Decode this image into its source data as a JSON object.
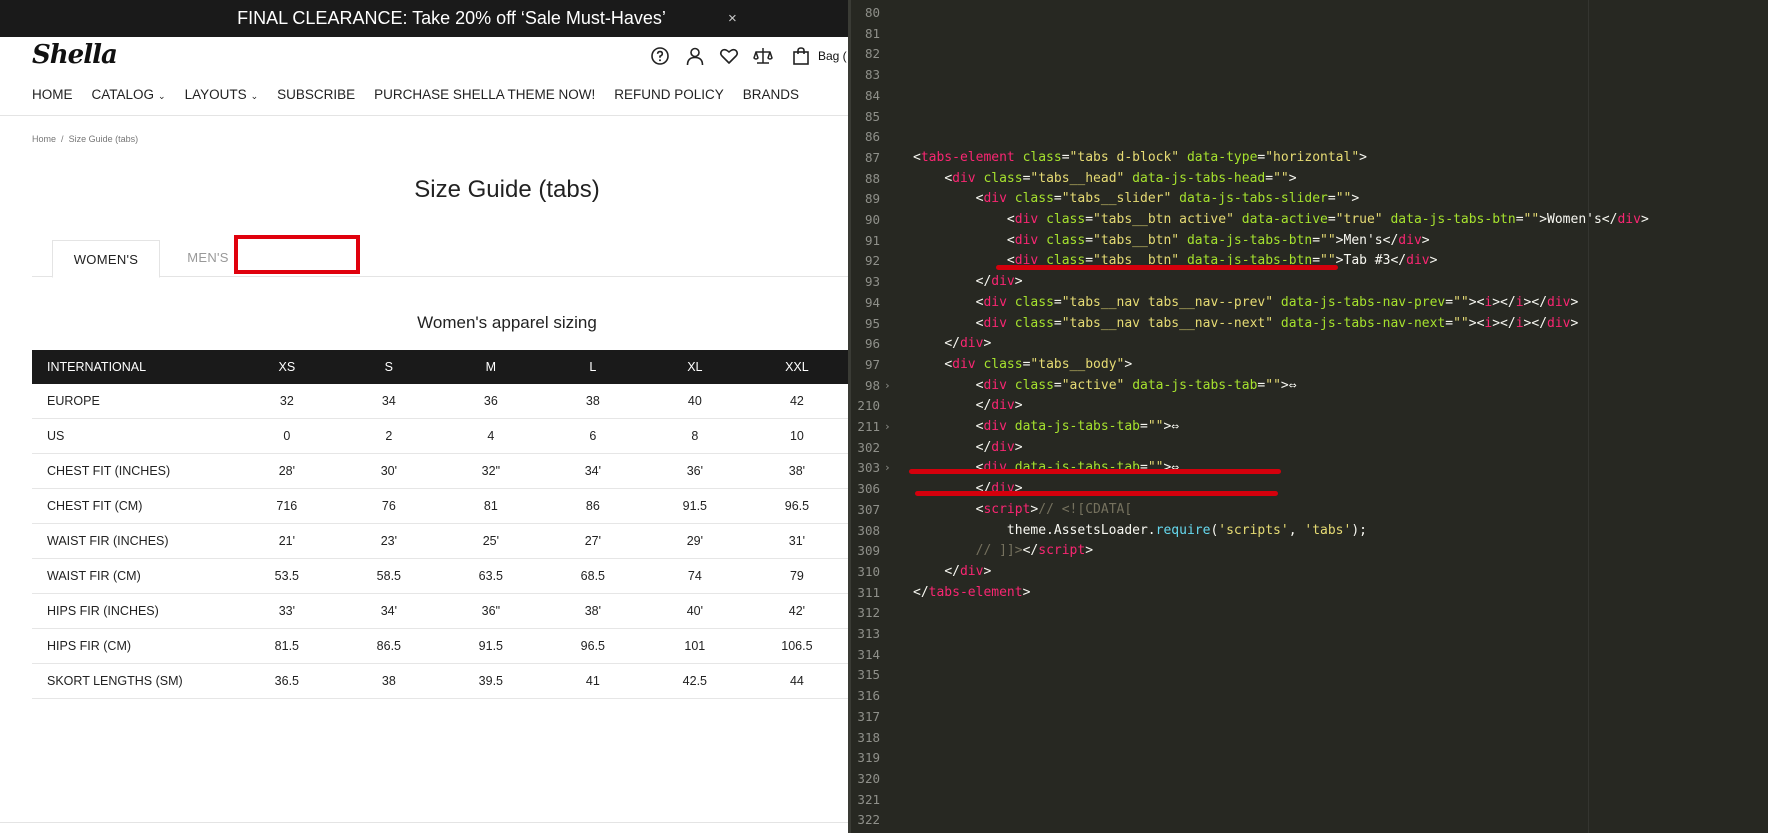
{
  "promo": {
    "text": "FINAL CLEARANCE: Take 20% off ‘Sale Must-Haves’",
    "close": "×"
  },
  "header": {
    "logo": "Shella",
    "bag_label": "Bag (",
    "icons": [
      "help-icon",
      "user-icon",
      "heart-icon",
      "compare-icon",
      "bag-icon"
    ]
  },
  "nav": {
    "items": [
      "HOME",
      "CATALOG",
      "LAYOUTS",
      "SUBSCRIBE",
      "PURCHASE SHELLA THEME NOW!",
      "REFUND POLICY",
      "BRANDS"
    ]
  },
  "breadcrumb": {
    "home": "Home",
    "sep": "/",
    "current": "Size Guide (tabs)"
  },
  "page": {
    "title": "Size Guide (tabs)",
    "subtitle": "Women's apparel sizing"
  },
  "tabs": {
    "women": "WOMEN'S",
    "men": "MEN'S"
  },
  "table": {
    "headers": [
      "INTERNATIONAL",
      "XS",
      "S",
      "M",
      "L",
      "XL",
      "XXL"
    ],
    "rows": [
      [
        "EUROPE",
        "32",
        "34",
        "36",
        "38",
        "40",
        "42"
      ],
      [
        "US",
        "0",
        "2",
        "4",
        "6",
        "8",
        "10"
      ],
      [
        "CHEST FIT (INCHES)",
        "28'",
        "30'",
        "32\"",
        "34'",
        "36'",
        "38'"
      ],
      [
        "CHEST FIT (CM)",
        "716",
        "76",
        "81",
        "86",
        "91.5",
        "96.5"
      ],
      [
        "WAIST FIR (INCHES)",
        "21'",
        "23'",
        "25'",
        "27'",
        "29'",
        "31'"
      ],
      [
        "WAIST FIR (CM)",
        "53.5",
        "58.5",
        "63.5",
        "68.5",
        "74",
        "79"
      ],
      [
        "HIPS FIR (INCHES)",
        "33'",
        "34'",
        "36\"",
        "38'",
        "40'",
        "42'"
      ],
      [
        "HIPS FIR (CM)",
        "81.5",
        "86.5",
        "91.5",
        "96.5",
        "101",
        "106.5"
      ],
      [
        "SKORT LENGTHS (SM)",
        "36.5",
        "38",
        "39.5",
        "41",
        "42.5",
        "44"
      ]
    ]
  },
  "editor": {
    "colors": {
      "background": "#272822",
      "tag": "#f92672",
      "attr": "#a6e22e",
      "string": "#e6db74",
      "comment": "#75715e",
      "annotation": "#d4000c"
    },
    "lines": [
      {
        "n": "80",
        "fold": false,
        "html": ""
      },
      {
        "n": "81",
        "fold": false,
        "html": ""
      },
      {
        "n": "82",
        "fold": false,
        "html": ""
      },
      {
        "n": "83",
        "fold": false,
        "html": ""
      },
      {
        "n": "84",
        "fold": false,
        "html": ""
      },
      {
        "n": "85",
        "fold": false,
        "html": ""
      },
      {
        "n": "86",
        "fold": false,
        "html": ""
      },
      {
        "n": "87",
        "fold": false,
        "html": "<span class=\"tx\">&lt;</span><span class=\"tg\">tabs-element</span> <span class=\"at\">class</span><span class=\"tx\">=</span><span class=\"st\">\"tabs d-block\"</span> <span class=\"at\">data-type</span><span class=\"tx\">=</span><span class=\"st\">\"horizontal\"</span><span class=\"tx\">&gt;</span>"
      },
      {
        "n": "88",
        "fold": false,
        "html": "    <span class=\"tx\">&lt;</span><span class=\"tg\">div</span> <span class=\"at\">class</span><span class=\"tx\">=</span><span class=\"st\">\"tabs__head\"</span> <span class=\"at\">data-js-tabs-head</span><span class=\"tx\">=</span><span class=\"st\">\"\"</span><span class=\"tx\">&gt;</span>"
      },
      {
        "n": "89",
        "fold": false,
        "html": "        <span class=\"tx\">&lt;</span><span class=\"tg\">div</span> <span class=\"at\">class</span><span class=\"tx\">=</span><span class=\"st\">\"tabs__slider\"</span> <span class=\"at\">data-js-tabs-slider</span><span class=\"tx\">=</span><span class=\"st\">\"\"</span><span class=\"tx\">&gt;</span>"
      },
      {
        "n": "90",
        "fold": false,
        "html": "            <span class=\"tx\">&lt;</span><span class=\"tg\">div</span> <span class=\"at\">class</span><span class=\"tx\">=</span><span class=\"st\">\"tabs__btn active\"</span> <span class=\"at\">data-active</span><span class=\"tx\">=</span><span class=\"st\">\"true\"</span> <span class=\"at\">data-js-tabs-btn</span><span class=\"tx\">=</span><span class=\"st\">\"\"</span><span class=\"tx\">&gt;Women's&lt;/</span><span class=\"tg\">div</span><span class=\"tx\">&gt;</span>"
      },
      {
        "n": "91",
        "fold": false,
        "html": "            <span class=\"tx\">&lt;</span><span class=\"tg\">div</span> <span class=\"at\">class</span><span class=\"tx\">=</span><span class=\"st\">\"tabs__btn\"</span> <span class=\"at\">data-js-tabs-btn</span><span class=\"tx\">=</span><span class=\"st\">\"\"</span><span class=\"tx\">&gt;Men's&lt;/</span><span class=\"tg\">div</span><span class=\"tx\">&gt;</span>"
      },
      {
        "n": "92",
        "fold": false,
        "html": "            <span class=\"tx\">&lt;</span><span class=\"tg\">div</span> <span class=\"at\">class</span><span class=\"tx\">=</span><span class=\"st\">\"tabs__btn\"</span> <span class=\"at\">data-js-tabs-btn</span><span class=\"tx\">=</span><span class=\"st\">\"\"</span><span class=\"tx\">&gt;Tab #3&lt;/</span><span class=\"tg\">div</span><span class=\"tx\">&gt;</span>"
      },
      {
        "n": "93",
        "fold": false,
        "html": "        <span class=\"tx\">&lt;/</span><span class=\"tg\">div</span><span class=\"tx\">&gt;</span>"
      },
      {
        "n": "94",
        "fold": false,
        "html": "        <span class=\"tx\">&lt;</span><span class=\"tg\">div</span> <span class=\"at\">class</span><span class=\"tx\">=</span><span class=\"st\">\"tabs__nav tabs__nav--prev\"</span> <span class=\"at\">data-js-tabs-nav-prev</span><span class=\"tx\">=</span><span class=\"st\">\"\"</span><span class=\"tx\">&gt;&lt;</span><span class=\"tg\">i</span><span class=\"tx\">&gt;&lt;/</span><span class=\"tg\">i</span><span class=\"tx\">&gt;&lt;/</span><span class=\"tg\">div</span><span class=\"tx\">&gt;</span>"
      },
      {
        "n": "95",
        "fold": false,
        "html": "        <span class=\"tx\">&lt;</span><span class=\"tg\">div</span> <span class=\"at\">class</span><span class=\"tx\">=</span><span class=\"st\">\"tabs__nav tabs__nav--next\"</span> <span class=\"at\">data-js-tabs-nav-next</span><span class=\"tx\">=</span><span class=\"st\">\"\"</span><span class=\"tx\">&gt;&lt;</span><span class=\"tg\">i</span><span class=\"tx\">&gt;&lt;/</span><span class=\"tg\">i</span><span class=\"tx\">&gt;&lt;/</span><span class=\"tg\">div</span><span class=\"tx\">&gt;</span>"
      },
      {
        "n": "96",
        "fold": false,
        "html": "    <span class=\"tx\">&lt;/</span><span class=\"tg\">div</span><span class=\"tx\">&gt;</span>"
      },
      {
        "n": "97",
        "fold": false,
        "html": "    <span class=\"tx\">&lt;</span><span class=\"tg\">div</span> <span class=\"at\">class</span><span class=\"tx\">=</span><span class=\"st\">\"tabs__body\"</span><span class=\"tx\">&gt;</span>"
      },
      {
        "n": "98",
        "fold": true,
        "html": "        <span class=\"tx\">&lt;</span><span class=\"tg\">div</span> <span class=\"at\">class</span><span class=\"tx\">=</span><span class=\"st\">\"active\"</span> <span class=\"at\">data-js-tabs-tab</span><span class=\"tx\">=</span><span class=\"st\">\"\"</span><span class=\"tx\">&gt;⇔</span>"
      },
      {
        "n": "210",
        "fold": false,
        "html": "        <span class=\"tx\">&lt;/</span><span class=\"tg\">div</span><span class=\"tx\">&gt;</span>"
      },
      {
        "n": "211",
        "fold": true,
        "html": "        <span class=\"tx\">&lt;</span><span class=\"tg\">div</span> <span class=\"at\">data-js-tabs-tab</span><span class=\"tx\">=</span><span class=\"st\">\"\"</span><span class=\"tx\">&gt;⇔</span>"
      },
      {
        "n": "302",
        "fold": false,
        "html": "        <span class=\"tx\">&lt;/</span><span class=\"tg\">div</span><span class=\"tx\">&gt;</span>"
      },
      {
        "n": "303",
        "fold": true,
        "html": "        <span class=\"tx\">&lt;</span><span class=\"tg\">div</span> <span class=\"at\">data-js-tabs-tab</span><span class=\"tx\">=</span><span class=\"st\">\"\"</span><span class=\"tx\">&gt;⇔</span>"
      },
      {
        "n": "306",
        "fold": false,
        "html": "        <span class=\"tx\">&lt;/</span><span class=\"tg\">div</span><span class=\"tx\">&gt;</span>"
      },
      {
        "n": "307",
        "fold": false,
        "html": "        <span class=\"tx\">&lt;</span><span class=\"tg\">script</span><span class=\"tx\">&gt;</span><span class=\"cm\">// &lt;![CDATA[</span>"
      },
      {
        "n": "308",
        "fold": false,
        "html": "            <span class=\"tx\">theme.AssetsLoader.</span><span class=\"fn\">require</span><span class=\"tx\">(</span><span class=\"st\">'scripts'</span><span class=\"tx\">, </span><span class=\"st\">'tabs'</span><span class=\"tx\">);</span>"
      },
      {
        "n": "309",
        "fold": false,
        "html": "        <span class=\"cm\">// ]]&gt;</span><span class=\"tx\">&lt;/</span><span class=\"tg\">script</span><span class=\"tx\">&gt;</span>"
      },
      {
        "n": "310",
        "fold": false,
        "html": "    <span class=\"tx\">&lt;/</span><span class=\"tg\">div</span><span class=\"tx\">&gt;</span>"
      },
      {
        "n": "311",
        "fold": false,
        "html": "<span class=\"tx\">&lt;/</span><span class=\"tg\">tabs-element</span><span class=\"tx\">&gt;</span>"
      },
      {
        "n": "312",
        "fold": false,
        "html": ""
      },
      {
        "n": "313",
        "fold": false,
        "html": ""
      },
      {
        "n": "314",
        "fold": false,
        "html": ""
      },
      {
        "n": "315",
        "fold": false,
        "html": ""
      },
      {
        "n": "316",
        "fold": false,
        "html": ""
      },
      {
        "n": "317",
        "fold": false,
        "html": ""
      },
      {
        "n": "318",
        "fold": false,
        "html": ""
      },
      {
        "n": "319",
        "fold": false,
        "html": ""
      },
      {
        "n": "320",
        "fold": false,
        "html": ""
      },
      {
        "n": "321",
        "fold": false,
        "html": ""
      },
      {
        "n": "322",
        "fold": false,
        "html": ""
      }
    ]
  }
}
